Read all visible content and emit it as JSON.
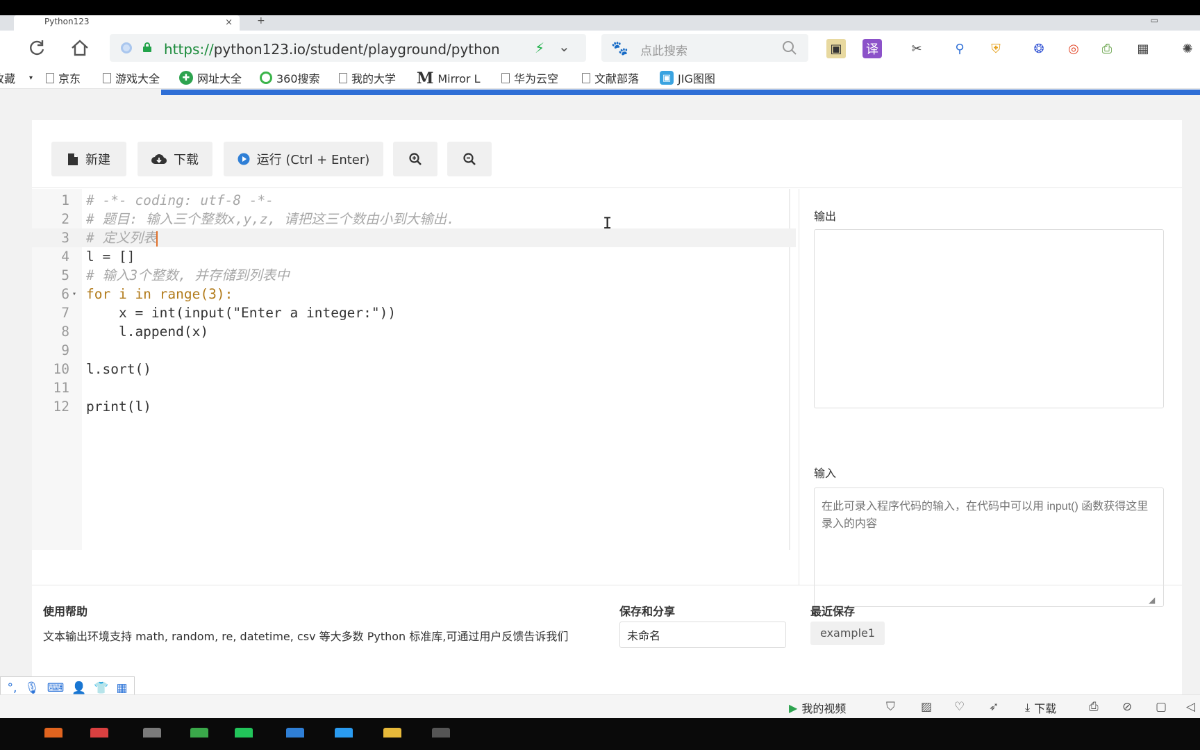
{
  "browser": {
    "tab_title": "Python123",
    "tab_close": "×",
    "new_tab": "+",
    "url_scheme": "https://",
    "url_rest": "python123.io/student/playground/python",
    "search_placeholder": "点此搜索"
  },
  "bookmarks": [
    {
      "label": "收藏",
      "icon": "star-icon"
    },
    {
      "label": "京东",
      "icon": "doc-icon"
    },
    {
      "label": "游戏大全",
      "icon": "doc-icon"
    },
    {
      "label": "网址大全",
      "icon": "plus-circle-icon"
    },
    {
      "label": "360搜索",
      "icon": "o-icon"
    },
    {
      "label": "我的大学",
      "icon": "doc-icon"
    },
    {
      "label": "Mirror L",
      "icon": "m-icon"
    },
    {
      "label": "华为云空",
      "icon": "doc-icon"
    },
    {
      "label": "文献部落",
      "icon": "doc-icon"
    },
    {
      "label": "JIG图图",
      "icon": "bilibili-icon"
    }
  ],
  "toolbar": {
    "new_label": "新建",
    "download_label": "下载",
    "run_label": "运行 (Ctrl + Enter)"
  },
  "editor": {
    "lines": [
      "# -*- coding: utf-8 -*-",
      "# 题目: 输入三个整数x,y,z, 请把这三个数由小到大输出.",
      "# 定义列表",
      "l = []",
      "# 输入3个整数, 并存储到列表中",
      "for i in range(3):",
      "    x = int(input(\"Enter a integer:\"))",
      "    l.append(x)",
      "",
      "l.sort()",
      "",
      "print(l)"
    ],
    "line_numbers": [
      "1",
      "2",
      "3",
      "4",
      "5",
      "6",
      "7",
      "8",
      "9",
      "10",
      "11",
      "12"
    ]
  },
  "panel": {
    "output_label": "输出",
    "input_label": "输入",
    "input_placeholder": "在此可录入程序代码的输入，在代码中可以用 input() 函数获得这里录入的内容"
  },
  "footer": {
    "help_title": "使用帮助",
    "help_text": "文本输出环境支持 math, random, re, datetime, csv 等大多数 Python 标准库,可通过用户反馈告诉我们",
    "save_title": "保存和分享",
    "save_name": "未命名",
    "recent_title": "最近保存",
    "recent_item": "example1"
  },
  "statusbar": {
    "my_videos": "我的视频",
    "download": "下载"
  }
}
